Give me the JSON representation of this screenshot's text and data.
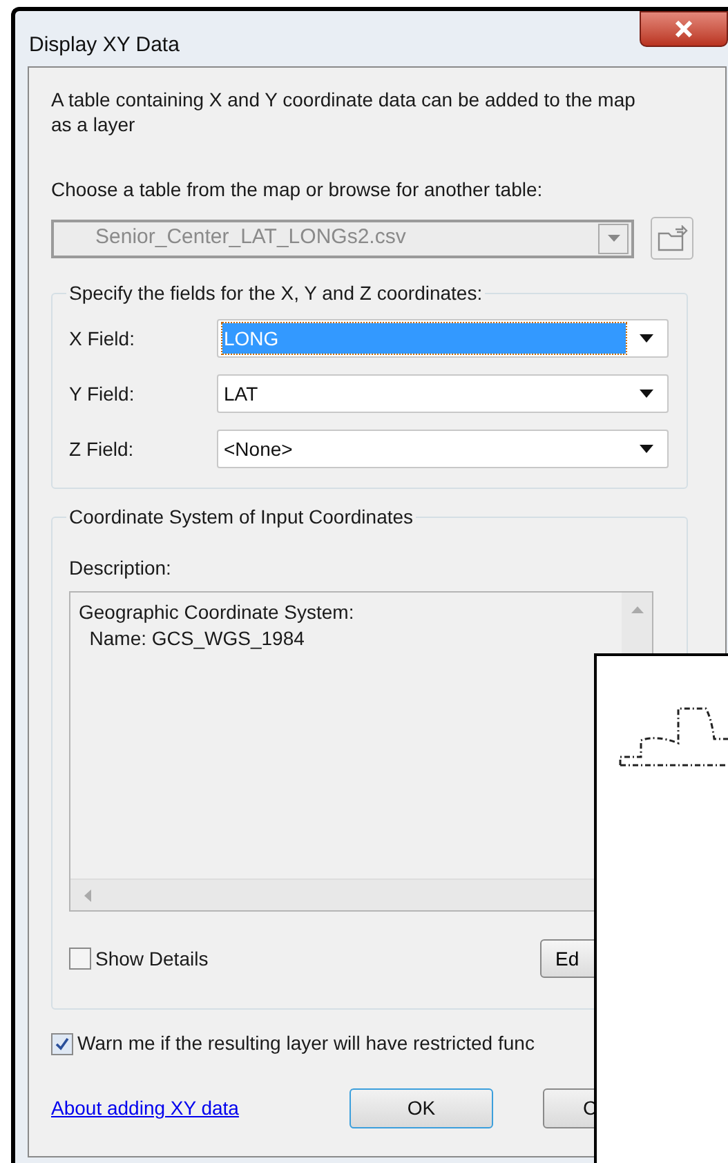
{
  "window": {
    "title": "Display XY Data"
  },
  "intro": "A table containing X and Y coordinate data can be added to the map as a layer",
  "choose_label": "Choose a table from the map or browse for another table:",
  "table_combo": {
    "value": "Senior_Center_LAT_LONGs2.csv",
    "disabled": true
  },
  "fields_group": {
    "title": "Specify the fields for the X, Y and Z coordinates:",
    "rows": [
      {
        "label": "X Field:",
        "value": "LONG",
        "selected": true
      },
      {
        "label": "Y Field:",
        "value": "LAT",
        "selected": false
      },
      {
        "label": "Z Field:",
        "value": "<None>",
        "selected": false
      }
    ]
  },
  "coord_group": {
    "title": "Coordinate System of Input Coordinates",
    "description_label": "Description:",
    "description_lines": [
      "Geographic Coordinate System:",
      "  Name: GCS_WGS_1984"
    ],
    "show_details": {
      "label": "Show Details",
      "checked": false
    },
    "edit_button": "Ed"
  },
  "warn": {
    "label": "Warn me if the resulting layer will have restricted func",
    "checked": true
  },
  "link": "About adding XY data",
  "buttons": [
    "OK",
    "C"
  ]
}
